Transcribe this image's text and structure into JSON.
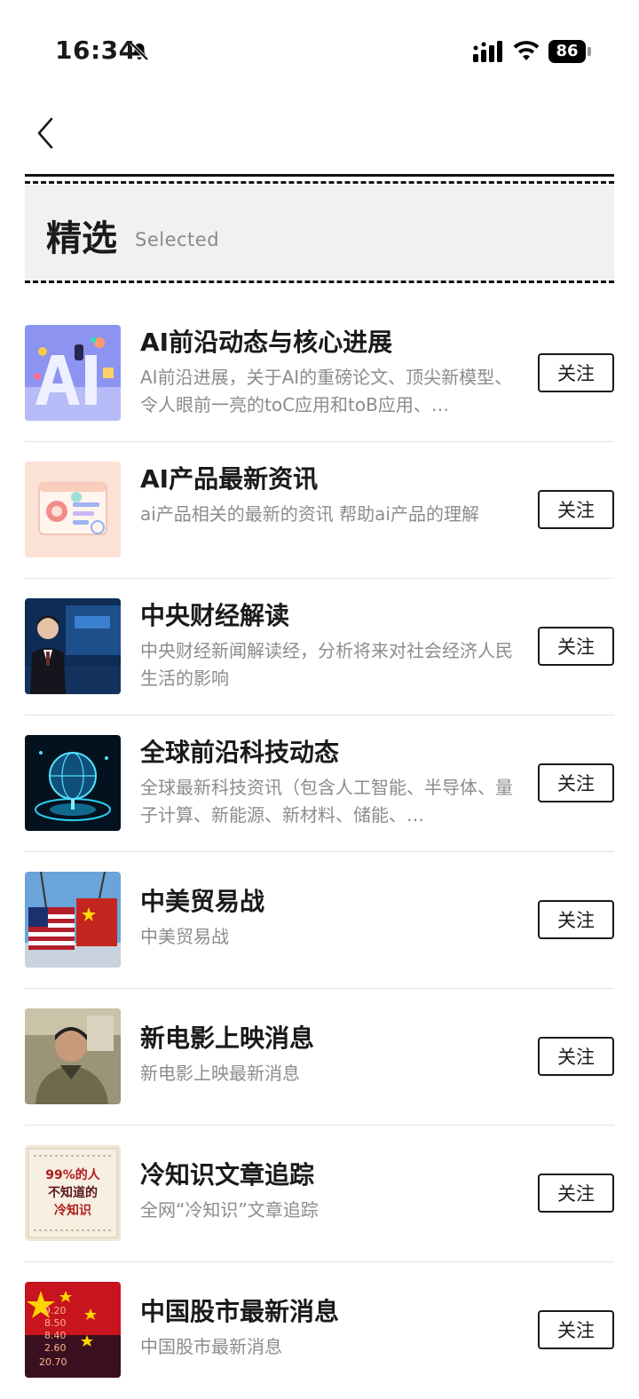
{
  "status_bar": {
    "time": "16:34",
    "battery": "86"
  },
  "header": {
    "title": "精选",
    "subtitle": "Selected"
  },
  "follow_label": "关注",
  "items": [
    {
      "title": "AI前沿动态与核心进展",
      "desc": "AI前沿进展，关于AI的重磅论文、顶尖新模型、令人眼前一亮的toC应用和toB应用、…",
      "thumb": "ai-letters-thumbnail"
    },
    {
      "title": "AI产品最新资讯",
      "desc": "ai产品相关的最新的资讯 帮助ai产品的理解",
      "thumb": "app-window-thumbnail"
    },
    {
      "title": "中央财经解读",
      "desc": "中央财经新闻解读经，分析将来对社会经济人民生活的影响",
      "thumb": "news-anchor-thumbnail"
    },
    {
      "title": "全球前沿科技动态",
      "desc": "全球最新科技资讯（包含人工智能、半导体、量子计算、新能源、新材料、储能、…",
      "thumb": "tech-globe-thumbnail"
    },
    {
      "title": "中美贸易战",
      "desc": "中美贸易战",
      "thumb": "trade-containers-thumbnail"
    },
    {
      "title": "新电影上映消息",
      "desc": "新电影上映最新消息",
      "thumb": "movie-actor-thumbnail"
    },
    {
      "title": "冷知识文章追踪",
      "desc": "全网“冷知识”文章追踪",
      "thumb": "trivia-poster-thumbnail",
      "thumb_text": {
        "line1": "99%的人",
        "line2": "不知道的",
        "line3": "冷知识"
      }
    },
    {
      "title": "中国股市最新消息",
      "desc": "中国股市最新消息",
      "thumb": "stock-flag-thumbnail",
      "thumb_numbers": [
        "9.20",
        "8.50",
        "8.40",
        "2.60",
        "20.70"
      ]
    }
  ]
}
